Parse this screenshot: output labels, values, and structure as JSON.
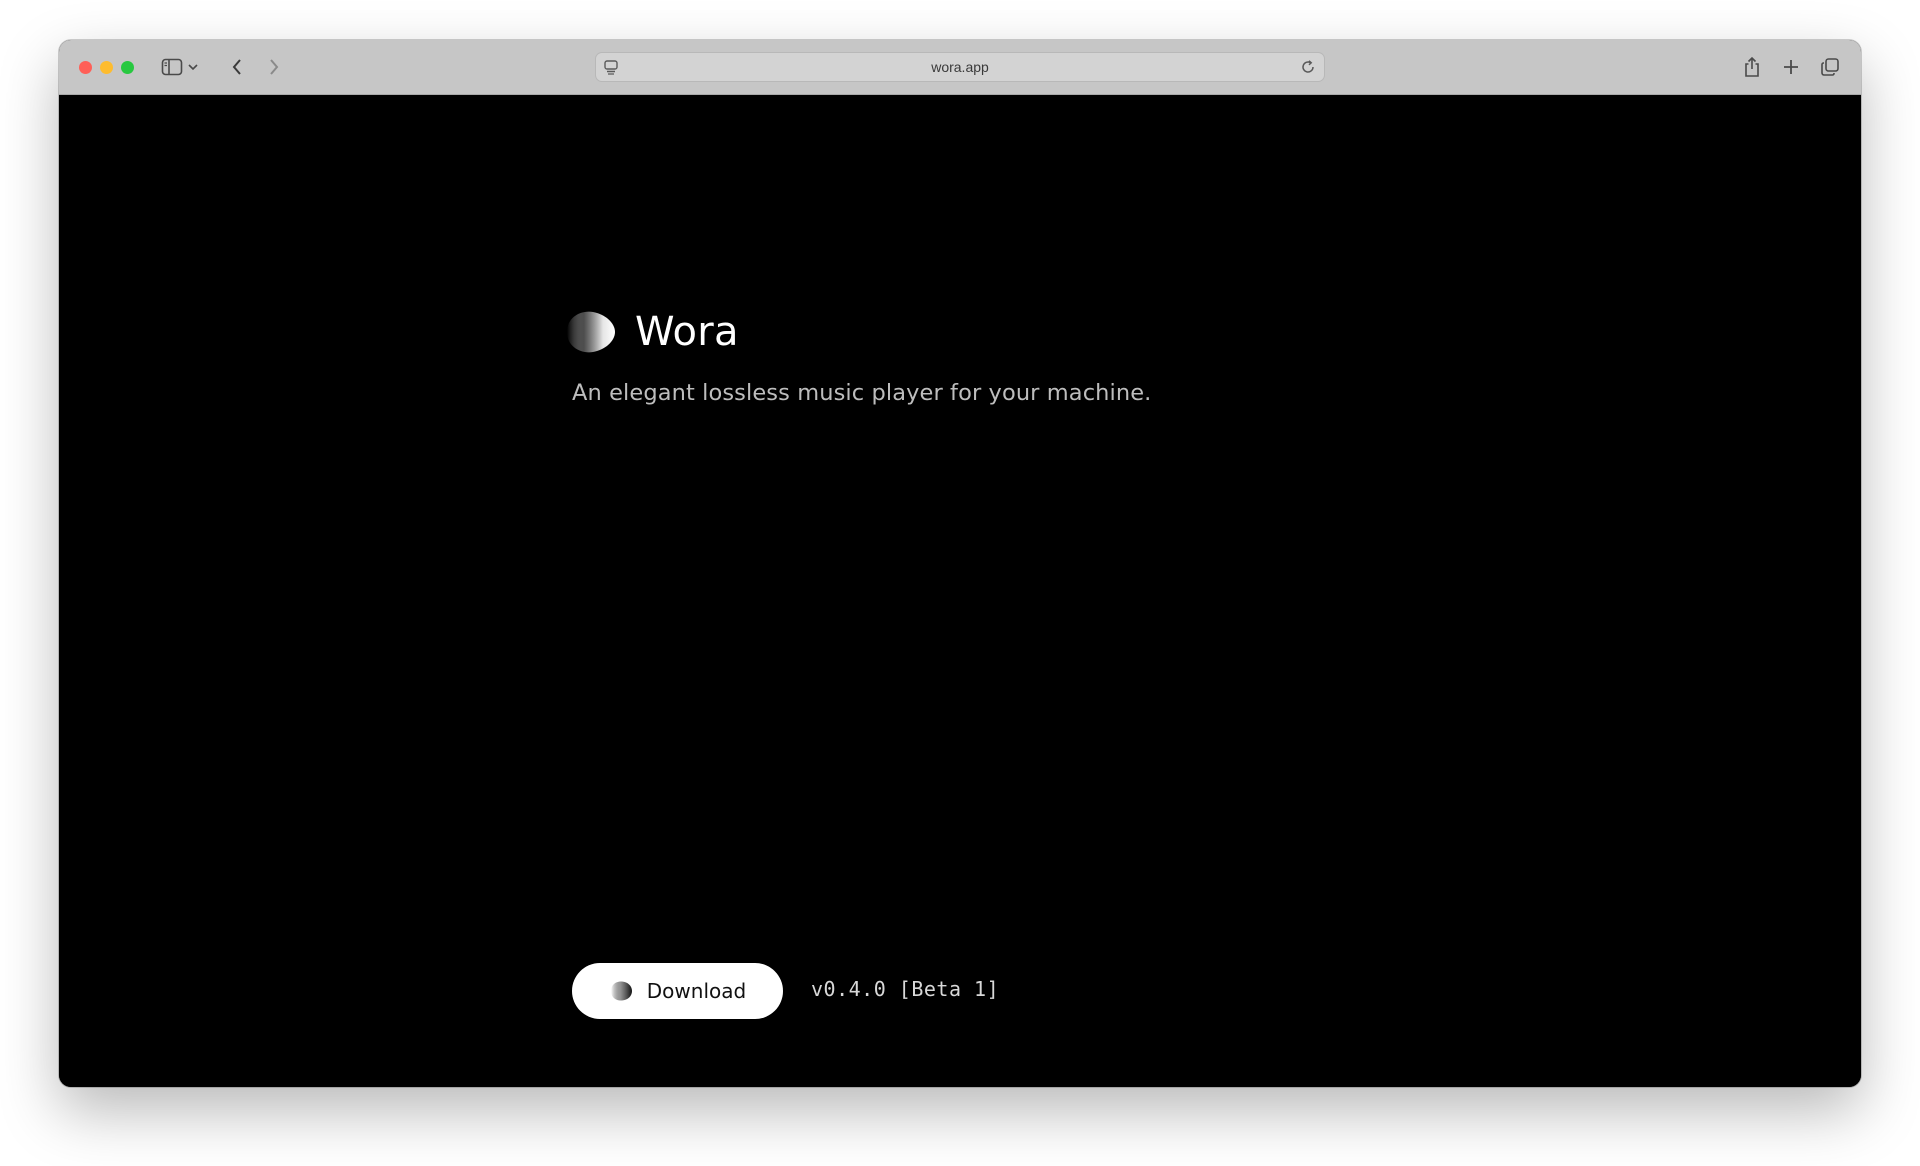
{
  "browser": {
    "url": "wora.app",
    "icons": {
      "close": "close-button",
      "minimize": "minimize-button",
      "zoom": "zoom-button",
      "sidebar": "sidebar-icon",
      "sidebar_menu": "chevron-down-icon",
      "back": "back-arrow-icon",
      "forward": "forward-arrow-icon",
      "page_menu": "page-menu-icon",
      "reload": "reload-icon",
      "share": "share-icon",
      "new_tab": "plus-icon",
      "tabs": "tab-overview-icon"
    },
    "colors": {
      "close": "#ff5f57",
      "minimize": "#febc2e",
      "zoom": "#28c840",
      "toolbar": "#c6c6c6"
    }
  },
  "page": {
    "app_name": "Wora",
    "tagline": "An elegant lossless music player for your machine.",
    "download_label": "Download",
    "version": "v0.4.0 [Beta 1]",
    "colors": {
      "background": "#000000",
      "text": "#ffffff",
      "subtext": "#bdbdbd",
      "button": "#ffffff"
    }
  }
}
